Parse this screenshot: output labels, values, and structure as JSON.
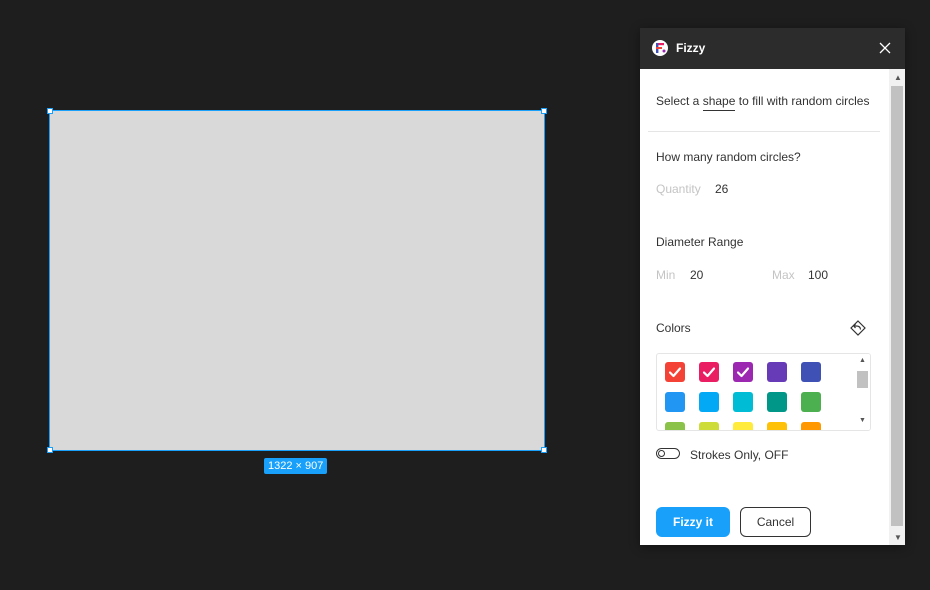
{
  "canvas": {
    "size_label": "1322 × 907",
    "frame_fill": "#d9d9d9",
    "selection_color": "#18a0fb"
  },
  "plugin": {
    "title": "Fizzy",
    "intro_before": "Select a ",
    "intro_shape": "shape",
    "intro_after": " to fill with random circles",
    "quantity_heading": "How many random circles?",
    "quantity_label": "Quantity",
    "quantity_value": "26",
    "diameter_heading": "Diameter Range",
    "min_label": "Min",
    "min_value": "20",
    "max_label": "Max",
    "max_value": "100",
    "colors_heading": "Colors",
    "colors": [
      {
        "hex": "#f44336",
        "checked": true
      },
      {
        "hex": "#e91e63",
        "checked": true
      },
      {
        "hex": "#9c27b0",
        "checked": true
      },
      {
        "hex": "#673ab7",
        "checked": false
      },
      {
        "hex": "#3f51b5",
        "checked": false
      },
      {
        "hex": "#2196f3",
        "checked": false
      },
      {
        "hex": "#03a9f4",
        "checked": false
      },
      {
        "hex": "#00bcd4",
        "checked": false
      },
      {
        "hex": "#009688",
        "checked": false
      },
      {
        "hex": "#4caf50",
        "checked": false
      },
      {
        "hex": "#8bc34a",
        "checked": false
      },
      {
        "hex": "#cddc39",
        "checked": false
      },
      {
        "hex": "#ffeb3b",
        "checked": false
      },
      {
        "hex": "#ffc107",
        "checked": false
      },
      {
        "hex": "#ff9800",
        "checked": false
      }
    ],
    "strokes_label": "Strokes Only, OFF",
    "strokes_on": false,
    "submit_label": "Fizzy it",
    "cancel_label": "Cancel",
    "accent_color": "#18a0fb"
  }
}
